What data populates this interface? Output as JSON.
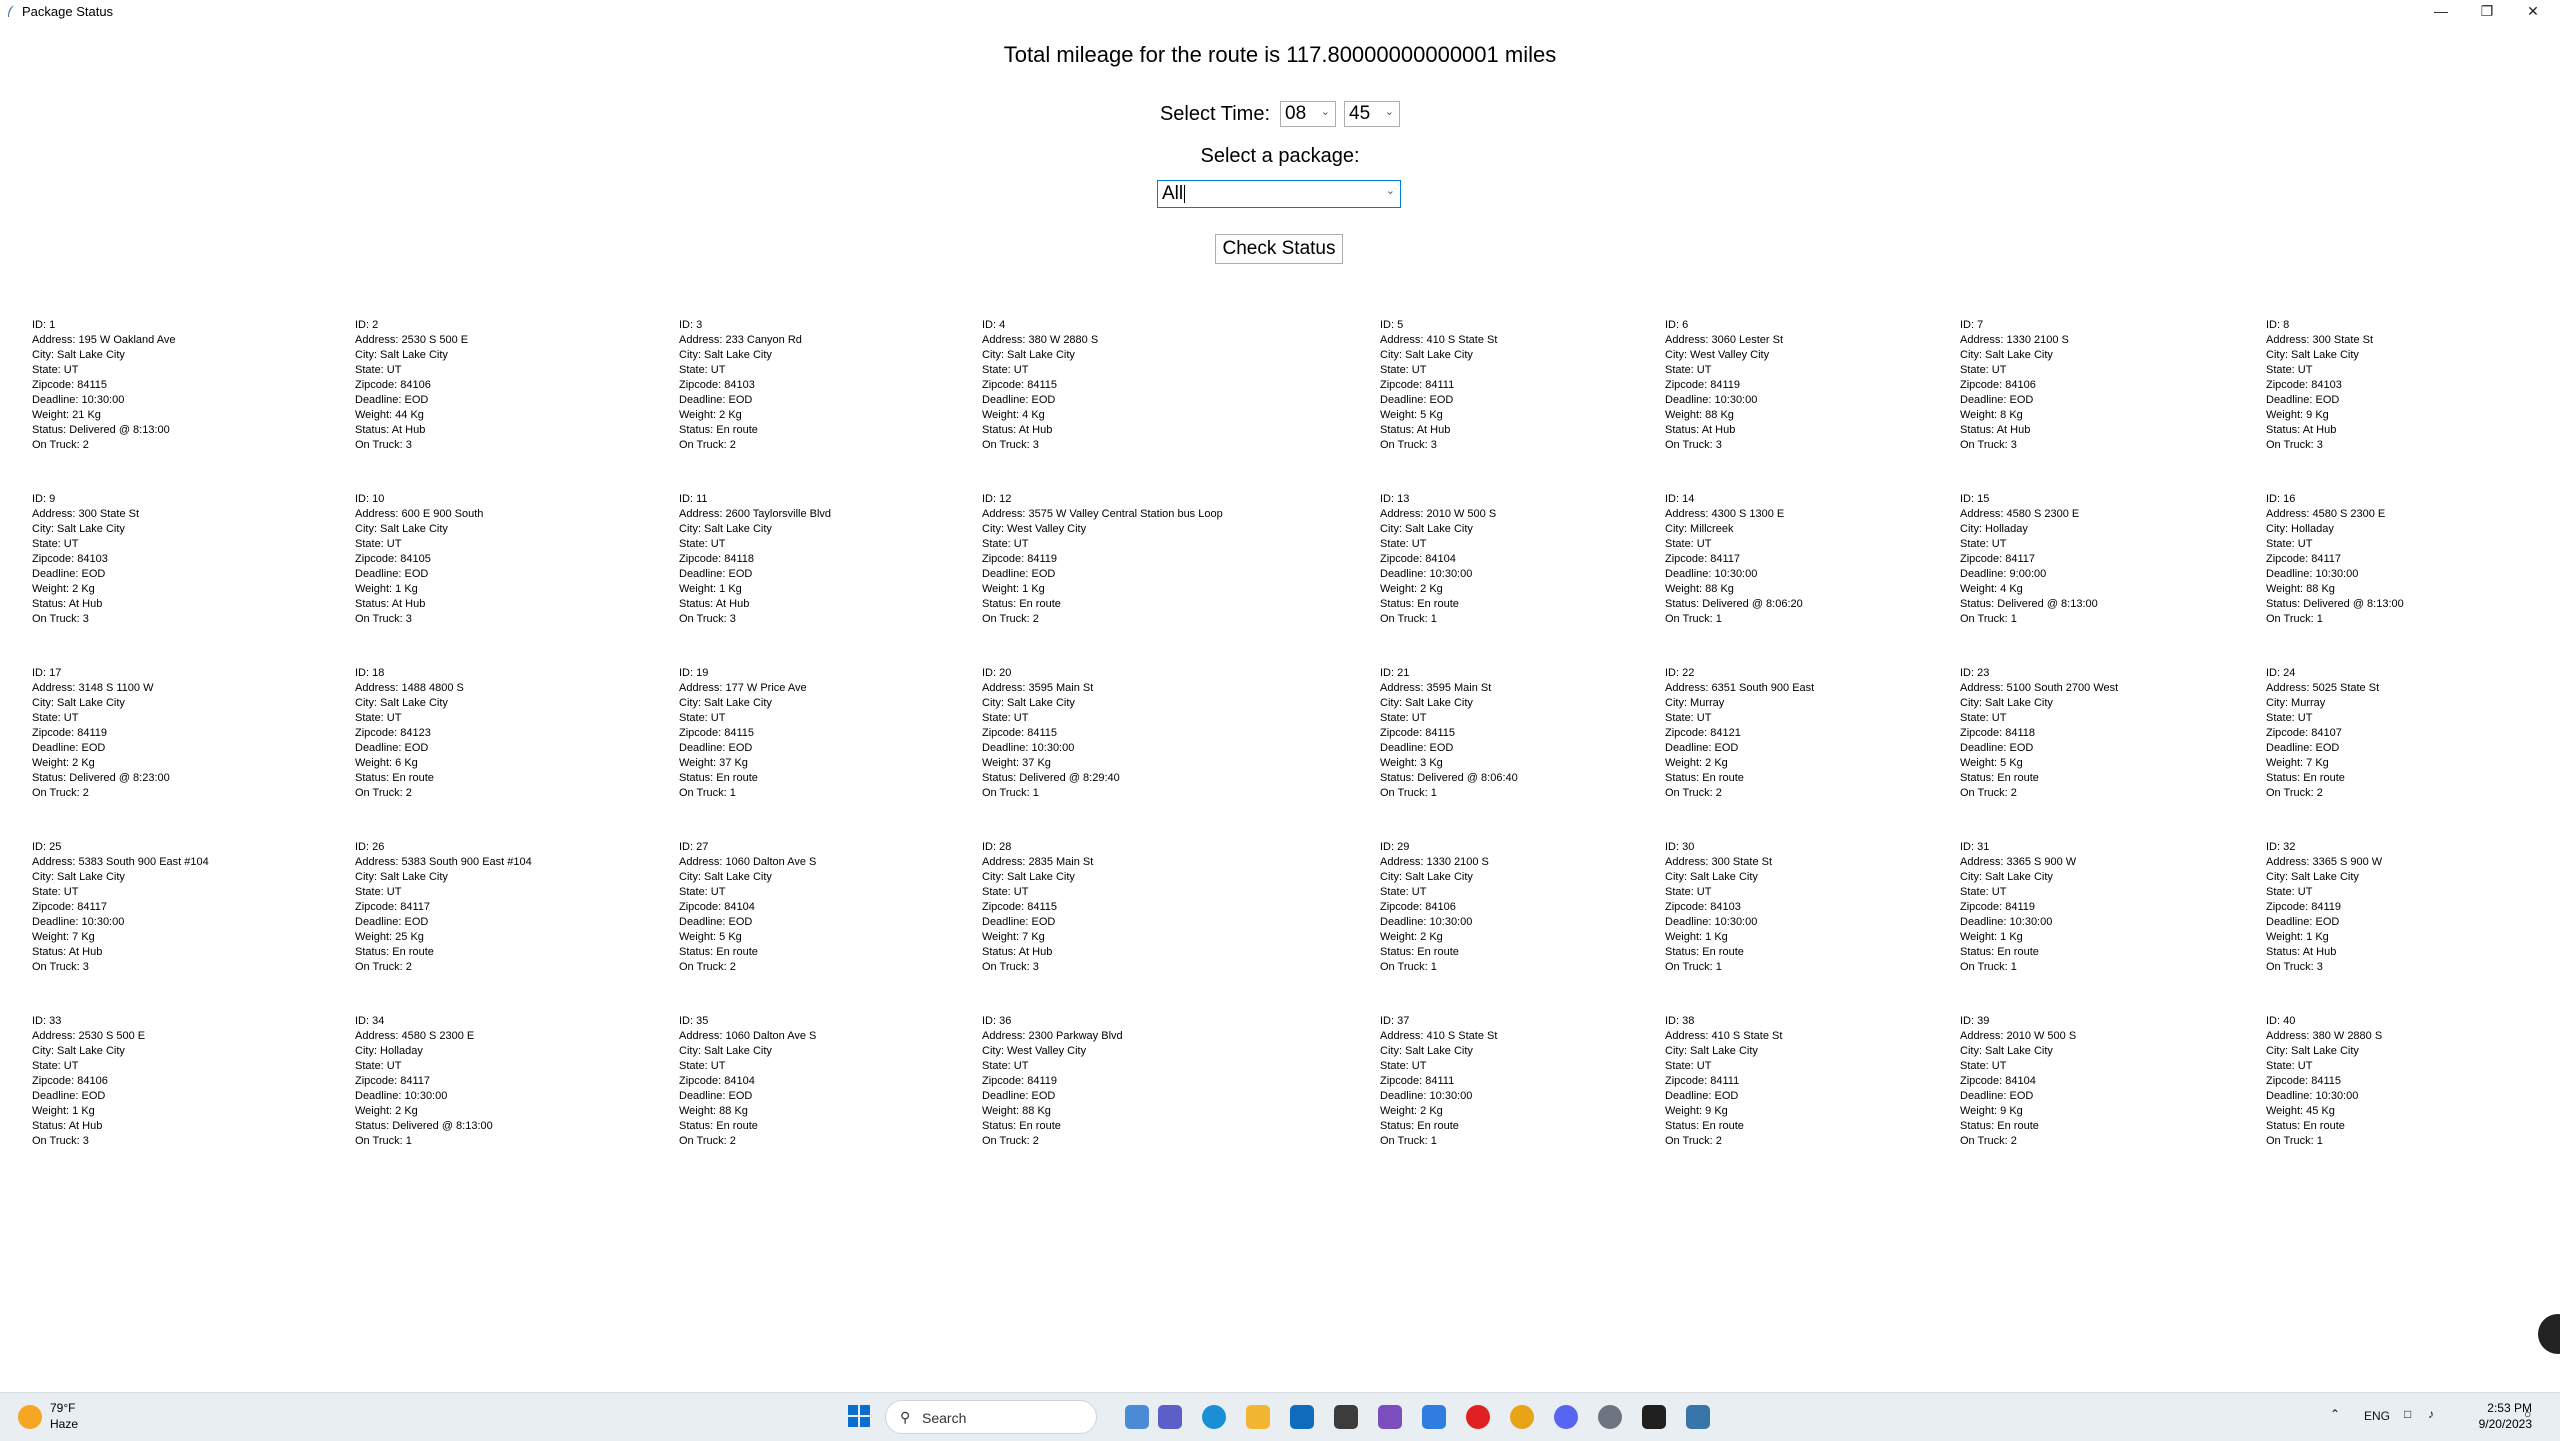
{
  "window": {
    "title": "Package Status",
    "minimize": "—",
    "maximize": "❐",
    "close": "✕"
  },
  "header": {
    "mileage_text": "Total mileage for the route is 117.80000000000001 miles",
    "select_time_label": "Select Time:",
    "hour_value": "08",
    "minute_value": "45",
    "select_package_label": "Select a package:",
    "package_value": "All",
    "check_status_label": "Check Status"
  },
  "packages": [
    {
      "id": "ID: 1",
      "address": "Address: 195 W Oakland Ave",
      "city": "City: Salt Lake City",
      "state": "State: UT",
      "zip": "Zipcode: 84115",
      "deadline": "Deadline: 10:30:00",
      "weight": "Weight: 21 Kg",
      "status": "Status: Delivered @ 8:13:00",
      "truck": "On Truck: 2"
    },
    {
      "id": "ID: 2",
      "address": "Address: 2530 S 500 E",
      "city": "City: Salt Lake City",
      "state": "State: UT",
      "zip": "Zipcode: 84106",
      "deadline": "Deadline: EOD",
      "weight": "Weight: 44 Kg",
      "status": "Status: At Hub",
      "truck": "On Truck: 3"
    },
    {
      "id": "ID: 3",
      "address": "Address: 233 Canyon Rd",
      "city": "City: Salt Lake City",
      "state": "State: UT",
      "zip": "Zipcode: 84103",
      "deadline": "Deadline: EOD",
      "weight": "Weight: 2 Kg",
      "status": "Status: En route",
      "truck": "On Truck: 2"
    },
    {
      "id": "ID: 4",
      "address": "Address: 380 W 2880 S",
      "city": "City: Salt Lake City",
      "state": "State: UT",
      "zip": "Zipcode: 84115",
      "deadline": "Deadline: EOD",
      "weight": "Weight: 4 Kg",
      "status": "Status: At Hub",
      "truck": "On Truck: 3"
    },
    {
      "id": "ID: 5",
      "address": "Address: 410 S State St",
      "city": "City: Salt Lake City",
      "state": "State: UT",
      "zip": "Zipcode: 84111",
      "deadline": "Deadline: EOD",
      "weight": "Weight: 5 Kg",
      "status": "Status: At Hub",
      "truck": "On Truck: 3"
    },
    {
      "id": "ID: 6",
      "address": "Address: 3060 Lester St",
      "city": "City: West Valley City",
      "state": "State: UT",
      "zip": "Zipcode: 84119",
      "deadline": "Deadline: 10:30:00",
      "weight": "Weight: 88 Kg",
      "status": "Status: At Hub",
      "truck": "On Truck: 3"
    },
    {
      "id": "ID: 7",
      "address": "Address: 1330 2100 S",
      "city": "City: Salt Lake City",
      "state": "State: UT",
      "zip": "Zipcode: 84106",
      "deadline": "Deadline: EOD",
      "weight": "Weight: 8 Kg",
      "status": "Status: At Hub",
      "truck": "On Truck: 3"
    },
    {
      "id": "ID: 8",
      "address": "Address: 300 State St",
      "city": "City: Salt Lake City",
      "state": "State: UT",
      "zip": "Zipcode: 84103",
      "deadline": "Deadline: EOD",
      "weight": "Weight: 9 Kg",
      "status": "Status: At Hub",
      "truck": "On Truck: 3"
    },
    {
      "id": "ID: 9",
      "address": "Address: 300 State St",
      "city": "City: Salt Lake City",
      "state": "State: UT",
      "zip": "Zipcode: 84103",
      "deadline": "Deadline: EOD",
      "weight": "Weight: 2 Kg",
      "status": "Status: At Hub",
      "truck": "On Truck: 3"
    },
    {
      "id": "ID: 10",
      "address": "Address: 600 E 900 South",
      "city": "City: Salt Lake City",
      "state": "State: UT",
      "zip": "Zipcode: 84105",
      "deadline": "Deadline: EOD",
      "weight": "Weight: 1 Kg",
      "status": "Status: At Hub",
      "truck": "On Truck: 3"
    },
    {
      "id": "ID: 11",
      "address": "Address: 2600 Taylorsville Blvd",
      "city": "City: Salt Lake City",
      "state": "State: UT",
      "zip": "Zipcode: 84118",
      "deadline": "Deadline: EOD",
      "weight": "Weight: 1 Kg",
      "status": "Status: At Hub",
      "truck": "On Truck: 3"
    },
    {
      "id": "ID: 12",
      "address": "Address: 3575 W Valley Central Station bus Loop",
      "city": "City: West Valley City",
      "state": "State: UT",
      "zip": "Zipcode: 84119",
      "deadline": "Deadline: EOD",
      "weight": "Weight: 1 Kg",
      "status": "Status: En route",
      "truck": "On Truck: 2"
    },
    {
      "id": "ID: 13",
      "address": "Address: 2010 W 500 S",
      "city": "City: Salt Lake City",
      "state": "State: UT",
      "zip": "Zipcode: 84104",
      "deadline": "Deadline: 10:30:00",
      "weight": "Weight: 2 Kg",
      "status": "Status: En route",
      "truck": "On Truck: 1"
    },
    {
      "id": "ID: 14",
      "address": "Address: 4300 S 1300 E",
      "city": "City: Millcreek",
      "state": "State: UT",
      "zip": "Zipcode: 84117",
      "deadline": "Deadline: 10:30:00",
      "weight": "Weight: 88 Kg",
      "status": "Status: Delivered @ 8:06:20",
      "truck": "On Truck: 1"
    },
    {
      "id": "ID: 15",
      "address": "Address: 4580 S 2300 E",
      "city": "City: Holladay",
      "state": "State: UT",
      "zip": "Zipcode: 84117",
      "deadline": "Deadline: 9:00:00",
      "weight": "Weight: 4 Kg",
      "status": "Status: Delivered @ 8:13:00",
      "truck": "On Truck: 1"
    },
    {
      "id": "ID: 16",
      "address": "Address: 4580 S 2300 E",
      "city": "City: Holladay",
      "state": "State: UT",
      "zip": "Zipcode: 84117",
      "deadline": "Deadline: 10:30:00",
      "weight": "Weight: 88 Kg",
      "status": "Status: Delivered @ 8:13:00",
      "truck": "On Truck: 1"
    },
    {
      "id": "ID: 17",
      "address": "Address: 3148 S 1100 W",
      "city": "City: Salt Lake City",
      "state": "State: UT",
      "zip": "Zipcode: 84119",
      "deadline": "Deadline: EOD",
      "weight": "Weight: 2 Kg",
      "status": "Status: Delivered @ 8:23:00",
      "truck": "On Truck: 2"
    },
    {
      "id": "ID: 18",
      "address": "Address: 1488 4800 S",
      "city": "City: Salt Lake City",
      "state": "State: UT",
      "zip": "Zipcode: 84123",
      "deadline": "Deadline: EOD",
      "weight": "Weight: 6 Kg",
      "status": "Status: En route",
      "truck": "On Truck: 2"
    },
    {
      "id": "ID: 19",
      "address": "Address: 177 W Price Ave",
      "city": "City: Salt Lake City",
      "state": "State: UT",
      "zip": "Zipcode: 84115",
      "deadline": "Deadline: EOD",
      "weight": "Weight: 37 Kg",
      "status": "Status: En route",
      "truck": "On Truck: 1"
    },
    {
      "id": "ID: 20",
      "address": "Address: 3595 Main St",
      "city": "City: Salt Lake City",
      "state": "State: UT",
      "zip": "Zipcode: 84115",
      "deadline": "Deadline: 10:30:00",
      "weight": "Weight: 37 Kg",
      "status": "Status: Delivered @ 8:29:40",
      "truck": "On Truck: 1"
    },
    {
      "id": "ID: 21",
      "address": "Address: 3595 Main St",
      "city": "City: Salt Lake City",
      "state": "State: UT",
      "zip": "Zipcode: 84115",
      "deadline": "Deadline: EOD",
      "weight": "Weight: 3 Kg",
      "status": "Status: Delivered @ 8:06:40",
      "truck": "On Truck: 1"
    },
    {
      "id": "ID: 22",
      "address": "Address: 6351 South 900 East",
      "city": "City: Murray",
      "state": "State: UT",
      "zip": "Zipcode: 84121",
      "deadline": "Deadline: EOD",
      "weight": "Weight: 2 Kg",
      "status": "Status: En route",
      "truck": "On Truck: 2"
    },
    {
      "id": "ID: 23",
      "address": "Address: 5100 South 2700 West",
      "city": "City: Salt Lake City",
      "state": "State: UT",
      "zip": "Zipcode: 84118",
      "deadline": "Deadline: EOD",
      "weight": "Weight: 5 Kg",
      "status": "Status: En route",
      "truck": "On Truck: 2"
    },
    {
      "id": "ID: 24",
      "address": "Address: 5025 State St",
      "city": "City: Murray",
      "state": "State: UT",
      "zip": "Zipcode: 84107",
      "deadline": "Deadline: EOD",
      "weight": "Weight: 7 Kg",
      "status": "Status: En route",
      "truck": "On Truck: 2"
    },
    {
      "id": "ID: 25",
      "address": "Address: 5383 South 900 East #104",
      "city": "City: Salt Lake City",
      "state": "State: UT",
      "zip": "Zipcode: 84117",
      "deadline": "Deadline: 10:30:00",
      "weight": "Weight: 7 Kg",
      "status": "Status: At Hub",
      "truck": "On Truck: 3"
    },
    {
      "id": "ID: 26",
      "address": "Address: 5383 South 900 East #104",
      "city": "City: Salt Lake City",
      "state": "State: UT",
      "zip": "Zipcode: 84117",
      "deadline": "Deadline: EOD",
      "weight": "Weight: 25 Kg",
      "status": "Status: En route",
      "truck": "On Truck: 2"
    },
    {
      "id": "ID: 27",
      "address": "Address: 1060 Dalton Ave S",
      "city": "City: Salt Lake City",
      "state": "State: UT",
      "zip": "Zipcode: 84104",
      "deadline": "Deadline: EOD",
      "weight": "Weight: 5 Kg",
      "status": "Status: En route",
      "truck": "On Truck: 2"
    },
    {
      "id": "ID: 28",
      "address": "Address: 2835 Main St",
      "city": "City: Salt Lake City",
      "state": "State: UT",
      "zip": "Zipcode: 84115",
      "deadline": "Deadline: EOD",
      "weight": "Weight: 7 Kg",
      "status": "Status: At Hub",
      "truck": "On Truck: 3"
    },
    {
      "id": "ID: 29",
      "address": "Address: 1330 2100 S",
      "city": "City: Salt Lake City",
      "state": "State: UT",
      "zip": "Zipcode: 84106",
      "deadline": "Deadline: 10:30:00",
      "weight": "Weight: 2 Kg",
      "status": "Status: En route",
      "truck": "On Truck: 1"
    },
    {
      "id": "ID: 30",
      "address": "Address: 300 State St",
      "city": "City: Salt Lake City",
      "state": "State: UT",
      "zip": "Zipcode: 84103",
      "deadline": "Deadline: 10:30:00",
      "weight": "Weight: 1 Kg",
      "status": "Status: En route",
      "truck": "On Truck: 1"
    },
    {
      "id": "ID: 31",
      "address": "Address: 3365 S 900 W",
      "city": "City: Salt Lake City",
      "state": "State: UT",
      "zip": "Zipcode: 84119",
      "deadline": "Deadline: 10:30:00",
      "weight": "Weight: 1 Kg",
      "status": "Status: En route",
      "truck": "On Truck: 1"
    },
    {
      "id": "ID: 32",
      "address": "Address: 3365 S 900 W",
      "city": "City: Salt Lake City",
      "state": "State: UT",
      "zip": "Zipcode: 84119",
      "deadline": "Deadline: EOD",
      "weight": "Weight: 1 Kg",
      "status": "Status: At Hub",
      "truck": "On Truck: 3"
    },
    {
      "id": "ID: 33",
      "address": "Address: 2530 S 500 E",
      "city": "City: Salt Lake City",
      "state": "State: UT",
      "zip": "Zipcode: 84106",
      "deadline": "Deadline: EOD",
      "weight": "Weight: 1 Kg",
      "status": "Status: At Hub",
      "truck": "On Truck: 3"
    },
    {
      "id": "ID: 34",
      "address": "Address: 4580 S 2300 E",
      "city": "City: Holladay",
      "state": "State: UT",
      "zip": "Zipcode: 84117",
      "deadline": "Deadline: 10:30:00",
      "weight": "Weight: 2 Kg",
      "status": "Status: Delivered @ 8:13:00",
      "truck": "On Truck: 1"
    },
    {
      "id": "ID: 35",
      "address": "Address: 1060 Dalton Ave S",
      "city": "City: Salt Lake City",
      "state": "State: UT",
      "zip": "Zipcode: 84104",
      "deadline": "Deadline: EOD",
      "weight": "Weight: 88 Kg",
      "status": "Status: En route",
      "truck": "On Truck: 2"
    },
    {
      "id": "ID: 36",
      "address": "Address: 2300 Parkway Blvd",
      "city": "City: West Valley City",
      "state": "State: UT",
      "zip": "Zipcode: 84119",
      "deadline": "Deadline: EOD",
      "weight": "Weight: 88 Kg",
      "status": "Status: En route",
      "truck": "On Truck: 2"
    },
    {
      "id": "ID: 37",
      "address": "Address: 410 S State St",
      "city": "City: Salt Lake City",
      "state": "State: UT",
      "zip": "Zipcode: 84111",
      "deadline": "Deadline: 10:30:00",
      "weight": "Weight: 2 Kg",
      "status": "Status: En route",
      "truck": "On Truck: 1"
    },
    {
      "id": "ID: 38",
      "address": "Address: 410 S State St",
      "city": "City: Salt Lake City",
      "state": "State: UT",
      "zip": "Zipcode: 84111",
      "deadline": "Deadline: EOD",
      "weight": "Weight: 9 Kg",
      "status": "Status: En route",
      "truck": "On Truck: 2"
    },
    {
      "id": "ID: 39",
      "address": "Address: 2010 W 500 S",
      "city": "City: Salt Lake City",
      "state": "State: UT",
      "zip": "Zipcode: 84104",
      "deadline": "Deadline: EOD",
      "weight": "Weight: 9 Kg",
      "status": "Status: En route",
      "truck": "On Truck: 2"
    },
    {
      "id": "ID: 40",
      "address": "Address: 380 W 2880 S",
      "city": "City: Salt Lake City",
      "state": "State: UT",
      "zip": "Zipcode: 84115",
      "deadline": "Deadline: 10:30:00",
      "weight": "Weight: 45 Kg",
      "status": "Status: En route",
      "truck": "On Truck: 1"
    }
  ],
  "taskbar": {
    "weather_temp": "79°F",
    "weather_desc": "Haze",
    "search_label": "Search",
    "language": "ENG",
    "time": "2:53 PM",
    "date": "9/20/2023",
    "app_icons": [
      "windows-start-icon",
      "search-icon",
      "widgets-icon",
      "task-view-icon",
      "teams-icon",
      "edge-icon",
      "file-explorer-icon",
      "mail-icon",
      "settings-app-icon",
      "visual-studio-icon",
      "todo-icon",
      "youtube-icon",
      "chrome-icon",
      "discord-icon",
      "gear-icon",
      "pycharm-icon",
      "python-app-icon"
    ]
  }
}
